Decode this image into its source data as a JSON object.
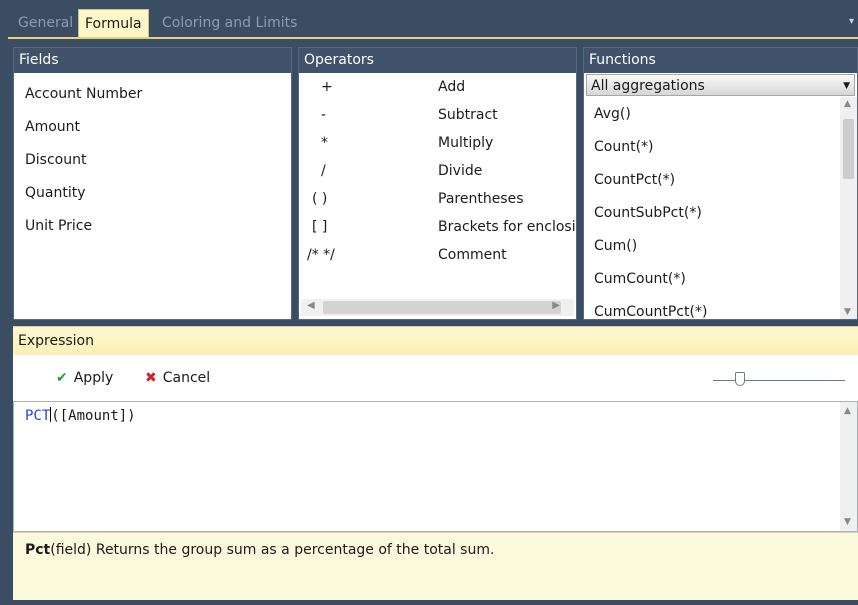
{
  "tabs": [
    {
      "label": "General"
    },
    {
      "label": "Formula"
    },
    {
      "label": "Coloring and Limits"
    }
  ],
  "fields": {
    "title": "Fields",
    "items": [
      "Account Number",
      "Amount",
      "Discount",
      "Quantity",
      "Unit Price"
    ]
  },
  "operators": {
    "title": "Operators",
    "items": [
      {
        "symbol": "+",
        "label": "Add"
      },
      {
        "symbol": "-",
        "label": "Subtract"
      },
      {
        "symbol": "*",
        "label": "Multiply"
      },
      {
        "symbol": "/",
        "label": "Divide"
      },
      {
        "symbol": "( )",
        "label": "Parentheses"
      },
      {
        "symbol": "[ ]",
        "label": "Brackets for enclosi"
      },
      {
        "symbol": "/* */",
        "label": "Comment"
      }
    ]
  },
  "functions": {
    "title": "Functions",
    "filter": "All aggregations",
    "items": [
      "Avg()",
      "Count(*)",
      "CountPct(*)",
      "CountSubPct(*)",
      "Cum()",
      "CumCount(*)",
      "CumCountPct(*)"
    ]
  },
  "expression": {
    "title": "Expression",
    "apply_label": "Apply",
    "cancel_label": "Cancel",
    "code_keyword": "PCT",
    "code_rest": "([Amount])"
  },
  "help": {
    "name": "Pct",
    "text": "(field) Returns the group sum as a percentage of the total sum."
  },
  "colors": {
    "header_bg": "#41536a",
    "accent": "#fdf6c6",
    "apply_icon": "#2e9a2e",
    "cancel_icon": "#c8262c",
    "keyword": "#2b3ee0"
  }
}
